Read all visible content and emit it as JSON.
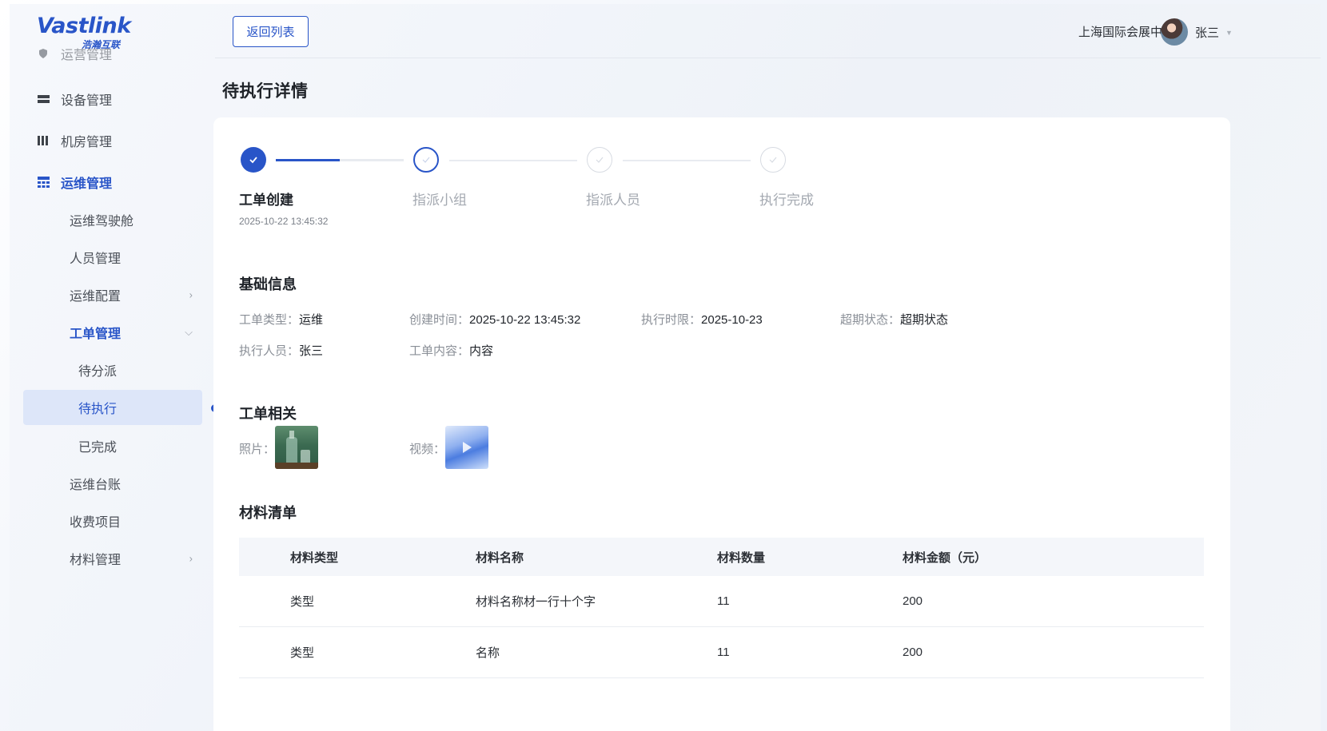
{
  "brand": {
    "name": "Vastlink",
    "subtitle": "浩瀚互联"
  },
  "sidebar": {
    "items": [
      {
        "label": "运营管理",
        "icon": "shield-icon"
      },
      {
        "label": "设备管理",
        "icon": "server-icon"
      },
      {
        "label": "机房管理",
        "icon": "rack-icon"
      },
      {
        "label": "运维管理",
        "icon": "grid-icon"
      }
    ],
    "ops_children": [
      {
        "label": "运维驾驶舱"
      },
      {
        "label": "人员管理"
      },
      {
        "label": "运维配置"
      },
      {
        "label": "工单管理"
      },
      {
        "label": "待分派"
      },
      {
        "label": "待执行"
      },
      {
        "label": "已完成"
      },
      {
        "label": "运维台账"
      },
      {
        "label": "收费项目"
      },
      {
        "label": "材料管理"
      }
    ]
  },
  "header": {
    "back_label": "返回列表",
    "venue": "上海国际会展中心",
    "user": "张三"
  },
  "page": {
    "title": "待执行详情"
  },
  "steps": [
    {
      "label": "工单创建",
      "time": "2025-10-22 13:45:32",
      "state": "done"
    },
    {
      "label": "指派小组",
      "state": "current"
    },
    {
      "label": "指派人员",
      "state": "todo"
    },
    {
      "label": "执行完成",
      "state": "todo"
    }
  ],
  "basic": {
    "title": "基础信息",
    "type_label": "工单类型：",
    "type_value": "运维",
    "created_label": "创建时间：",
    "created_value": "2025-10-22 13:45:32",
    "deadline_label": "执行时限：",
    "deadline_value": "2025-10-23",
    "overdue_label": "超期状态：",
    "overdue_value": "超期状态",
    "executor_label": "执行人员：",
    "executor_value": "张三",
    "content_label": "工单内容：",
    "content_value": "内容"
  },
  "related": {
    "title": "工单相关",
    "photo_label": "照片：",
    "video_label": "视频："
  },
  "materials": {
    "title": "材料清单",
    "columns": [
      "材料类型",
      "材料名称",
      "材料数量",
      "材料金额（元）"
    ],
    "rows": [
      [
        "类型",
        "材料名称材一行十个字",
        "11",
        "200"
      ],
      [
        "类型",
        "名称",
        "11",
        "200"
      ]
    ]
  }
}
